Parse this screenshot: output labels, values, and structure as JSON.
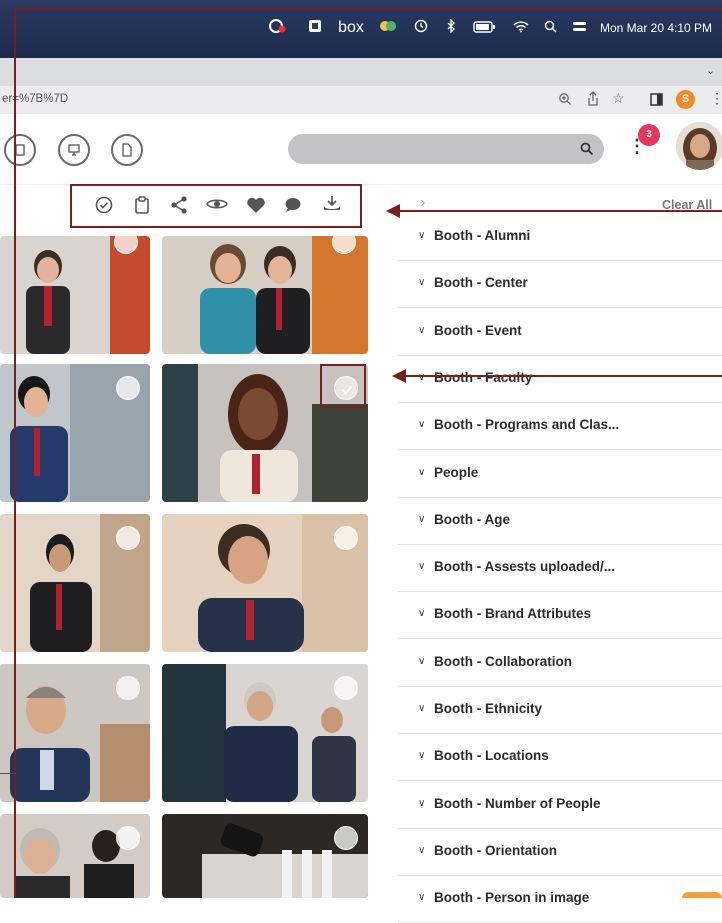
{
  "menubar": {
    "box_label": "box",
    "datetime": "Mon Mar 20  4:10 PM"
  },
  "browser": {
    "url_fragment": "er=%7B%7D",
    "profile_initial": "S"
  },
  "app": {
    "notification_count": "3",
    "search_placeholder": ""
  },
  "toolbar": {
    "icons": [
      "select-all-icon",
      "clipboard-icon",
      "share-icon",
      "view-icon",
      "favorite-icon",
      "comment-icon",
      "download-icon"
    ]
  },
  "filters": {
    "clear_all_label": "Clear All",
    "items": [
      "Booth - Alumni",
      "Booth - Center",
      "Booth - Event",
      "Booth - Faculty",
      "Booth - Programs and Clas...",
      "People",
      "Booth - Age",
      "Booth - Assests uploaded/...",
      "Booth - Brand Attributes",
      "Booth - Collaboration",
      "Booth - Ethnicity",
      "Booth - Locations",
      "Booth - Number of People",
      "Booth - Orientation",
      "Booth - Person in image"
    ]
  },
  "colors": {
    "annotation": "#7a1f1f",
    "badge": "#e8365d",
    "profile": "#f08a24"
  }
}
